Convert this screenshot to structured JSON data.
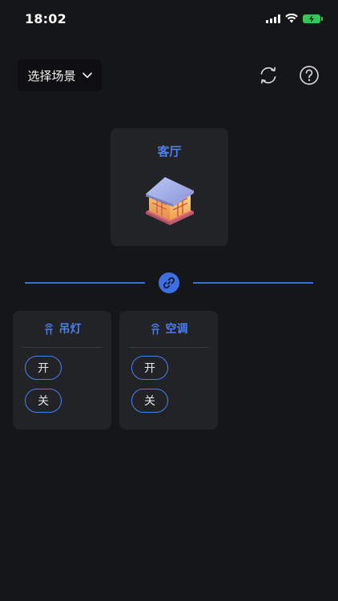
{
  "status": {
    "time": "18:02"
  },
  "header": {
    "scene_select_label": "选择场景"
  },
  "room": {
    "name": "客厅"
  },
  "devices": [
    {
      "name": "吊灯",
      "on_label": "开",
      "off_label": "关"
    },
    {
      "name": "空调",
      "on_label": "开",
      "off_label": "关"
    }
  ],
  "colors": {
    "accent": "#4a7ff0",
    "background": "#151618",
    "card": "#222326"
  },
  "icons": [
    "chevron-down-icon",
    "refresh-icon",
    "help-icon",
    "house-icon",
    "link-icon",
    "device-icon"
  ]
}
